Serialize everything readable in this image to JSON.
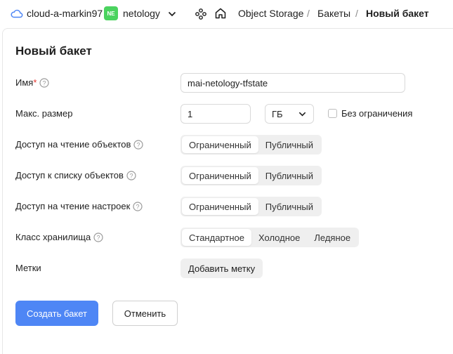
{
  "topbar": {
    "cloud_name": "cloud-a-markin97",
    "folder_badge": "NE",
    "folder_name": "netology",
    "breadcrumbs": [
      "Object Storage",
      "Бакеты",
      "Новый бакет"
    ],
    "separator": "/"
  },
  "form": {
    "title": "Новый бакет",
    "name": {
      "label": "Имя",
      "required_mark": "*",
      "value": "mai-netology-tfstate"
    },
    "max_size": {
      "label": "Макс. размер",
      "value": "1",
      "unit": "ГБ",
      "no_limit_label": "Без ограничения",
      "no_limit_checked": false
    },
    "read_objects": {
      "label": "Доступ на чтение объектов",
      "options": [
        "Ограниченный",
        "Публичный"
      ],
      "selected": "Ограниченный"
    },
    "list_objects": {
      "label": "Доступ к списку объектов",
      "options": [
        "Ограниченный",
        "Публичный"
      ],
      "selected": "Ограниченный"
    },
    "read_settings": {
      "label": "Доступ на чтение настроек",
      "options": [
        "Ограниченный",
        "Публичный"
      ],
      "selected": "Ограниченный"
    },
    "storage_class": {
      "label": "Класс хранилища",
      "options": [
        "Стандартное",
        "Холодное",
        "Ледяное"
      ],
      "selected": "Стандартное"
    },
    "tags": {
      "label": "Метки",
      "add_button": "Добавить метку"
    }
  },
  "actions": {
    "create_button": "Создать бакет",
    "cancel_button": "Отменить"
  },
  "colors": {
    "primary": "#4e86f5",
    "folder_badge": "#4bd35f",
    "required": "#e5342c"
  }
}
